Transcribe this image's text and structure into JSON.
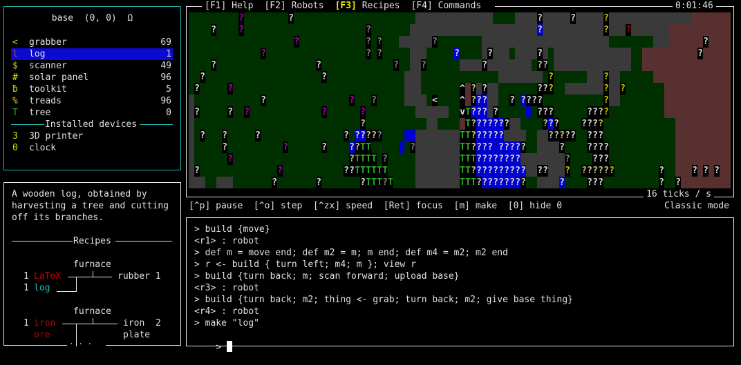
{
  "inventory": {
    "title": "base  (0, 0)  Ω",
    "items": [
      {
        "glyph": "<",
        "glyph_color": "#d8d800",
        "name": "grabber",
        "count": "69"
      },
      {
        "glyph": "l",
        "glyph_color": "#c05050",
        "name": "log",
        "count": "1",
        "selected": true
      },
      {
        "glyph": "$",
        "glyph_color": "#d8d800",
        "name": "scanner",
        "count": "49"
      },
      {
        "glyph": "#",
        "glyph_color": "#d8d800",
        "name": "solar panel",
        "count": "96"
      },
      {
        "glyph": "ƀ",
        "glyph_color": "#d8d800",
        "name": "toolkit",
        "count": "5"
      },
      {
        "glyph": "%",
        "glyph_color": "#d8d800",
        "name": "treads",
        "count": "96"
      },
      {
        "glyph": "T",
        "glyph_color": "#20b020",
        "name": "tree",
        "count": "0"
      }
    ],
    "devices_header": "Installed devices",
    "devices": [
      {
        "glyph": "3",
        "glyph_color": "#d8d800",
        "name": "3D printer"
      },
      {
        "glyph": "0",
        "glyph_color": "#d8d800",
        "name": "clock"
      }
    ]
  },
  "description": {
    "lines": [
      "A wooden log, obtained by",
      "harvesting a tree and cutting",
      "off its branches."
    ],
    "recipes_header": "Recipes",
    "recipe1": {
      "station": "furnace",
      "in1_qty": "1",
      "in1": "LaTeX",
      "in1_color": "#c00000",
      "in2_qty": "1",
      "in2": "log",
      "in2_color": "#20b8b8",
      "output": "rubber 1"
    },
    "recipe2": {
      "station": "furnace",
      "in1_qty": "1",
      "in1_a": "iron",
      "in1_b": "ore",
      "in1_color": "#c00000",
      "out_a": "iron  2",
      "out_b": "plate"
    },
    "more_indicator": "· · ·"
  },
  "tabs": [
    {
      "key": "[F1]",
      "label": "Help",
      "active": false
    },
    {
      "key": "[F2]",
      "label": "Robots",
      "active": false
    },
    {
      "key": "[F3]",
      "label": "Recipes",
      "active": true
    },
    {
      "key": "[F4]",
      "label": "Commands",
      "active": false
    }
  ],
  "clock": "0:01:46",
  "tick_rate": "16 ticks / s",
  "shortcuts": "[^p] pause  [^o] step  [^zx] speed  [Ret] focus  [m] make  [0] hide 0",
  "mode": "Classic mode",
  "repl": {
    "history": [
      "> build {move}",
      "<r1> : robot",
      "> def m = move end; def m2 = m; m end; def m4 = m2; m2 end",
      "> r <- build { turn left; m4; m }; view r",
      "> build {turn back; m; scan forward; upload base}",
      "<r3> : robot",
      "> build {turn back; m2; thing <- grab; turn back; m2; give base thing}",
      "<r4> : robot",
      "> make \"log\""
    ],
    "prompt": "> ",
    "input_value": ""
  },
  "map": {
    "colors": {
      "grass": "#003000",
      "stone": "#3a3a3a",
      "dirt": "#583030",
      "water": "#0000d0",
      "unknown_white": "#d8d8d8",
      "unknown_magenta": "#b000b0",
      "unknown_yellow": "#c8c800",
      "unknown_gray": "#808080",
      "unknown_red": "#c00000",
      "unknown_tan": "#c8c890",
      "tree": "#20b020"
    },
    "legend": {
      "?": "unknown entity",
      "T": "tree",
      "^": "robot facing north",
      "v": "robot facing south",
      "<": "robot facing west"
    }
  }
}
